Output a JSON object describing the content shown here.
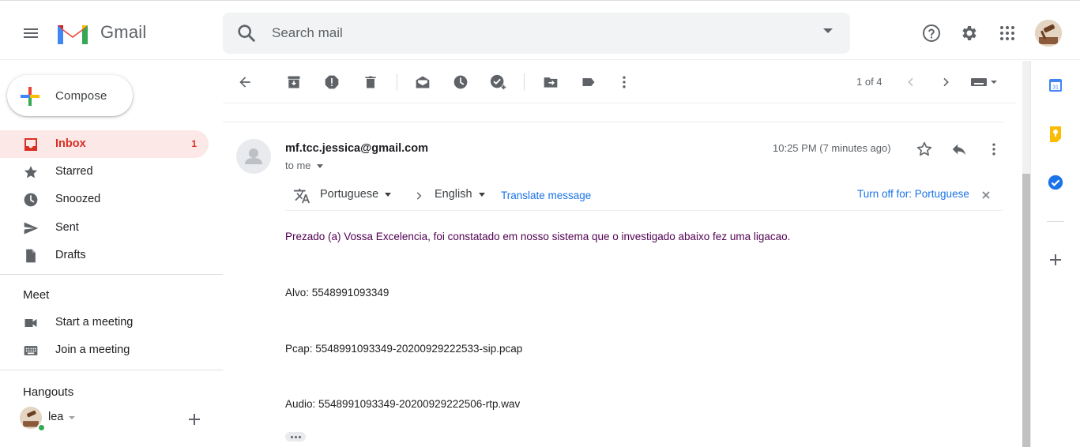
{
  "app": {
    "name": "Gmail"
  },
  "search": {
    "placeholder": "Search mail"
  },
  "sidebar": {
    "compose_label": "Compose",
    "items": [
      {
        "label": "Inbox",
        "count": "1",
        "icon": "inbox-icon"
      },
      {
        "label": "Starred",
        "icon": "star-icon"
      },
      {
        "label": "Snoozed",
        "icon": "clock-icon"
      },
      {
        "label": "Sent",
        "icon": "send-icon"
      },
      {
        "label": "Drafts",
        "icon": "draft-icon"
      }
    ],
    "meet": {
      "title": "Meet",
      "items": [
        {
          "label": "Start a meeting",
          "icon": "video-icon"
        },
        {
          "label": "Join a meeting",
          "icon": "keyboard-icon"
        }
      ]
    },
    "hangouts": {
      "title": "Hangouts",
      "user": "lea"
    }
  },
  "toolbar": {
    "pager": "1 of 4"
  },
  "message": {
    "sender": "mf.tcc.jessica@gmail.com",
    "to": "to me",
    "time": "10:25 PM (7 minutes ago)",
    "translate": {
      "from": "Portuguese",
      "to": "English",
      "action": "Translate message",
      "turn_off": "Turn off for: Portuguese"
    },
    "body": [
      "Prezado (a) Vossa Excelencia, foi constatado em nosso sistema que o investigado abaixo fez uma ligacao.",
      "Alvo: 5548991093349",
      "Pcap: 5548991093349-20200929222533-sip.pcap",
      "Audio: 5548991093349-20200929222506-rtp.wav"
    ]
  },
  "colors": {
    "accent_red": "#d93025",
    "link_blue": "#1a73e8",
    "body_purple": "#500050",
    "active_bg": "#fce8e6"
  }
}
